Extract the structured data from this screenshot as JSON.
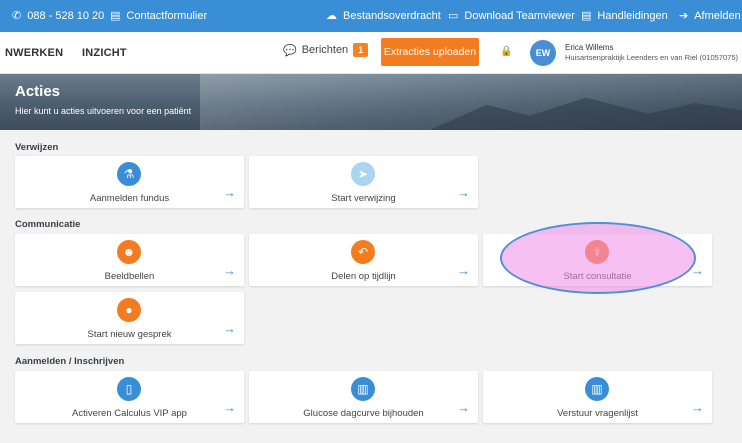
{
  "topbar": {
    "phone": "088 - 528 10 20",
    "contact": "Contactformulier",
    "transfer": "Bestandsoverdracht",
    "teamviewer": "Download Teamviewer",
    "manuals": "Handleidingen",
    "logout": "Afmelden"
  },
  "nav": {
    "tab1": "NWERKEN",
    "tab2": "INZICHT",
    "messages": "Berichten",
    "messages_count": "1",
    "upload": "Extracties uploaden",
    "avatar_initials": "EW",
    "user_name": "Erica Willems",
    "user_org": "Huisartsenpraktijk Leenders en van Riel (01057075)"
  },
  "banner": {
    "title": "Acties",
    "subtitle": "Hier kunt u acties uitvoeren voor een patiënt"
  },
  "sections": {
    "verwijzen": "Verwijzen",
    "communicatie": "Communicatie",
    "aanmelden": "Aanmelden / Inschrijven"
  },
  "cards": {
    "fundus": "Aanmelden fundus",
    "verwijzing": "Start verwijzing",
    "beeldbellen": "Beeldbellen",
    "tijdlijn": "Delen op tijdlijn",
    "consultatie": "Start consultatie",
    "gesprek": "Start nieuw gesprek",
    "calculus": "Activeren Calculus VIP app",
    "glucose": "Glucose dagcurve bijhouden",
    "vragenlijst": "Verstuur vragenlijst"
  },
  "colors": {
    "blue": "#3a8ed6",
    "orange": "#f47c20",
    "light_blue": "#a9d4f2",
    "highlight": "#f18cea"
  },
  "icons": {
    "phone": "phone-icon",
    "contact": "document-icon",
    "transfer": "cloud-upload-icon",
    "teamviewer": "monitor-icon",
    "manuals": "book-icon",
    "logout": "logout-icon",
    "messages": "chat-icon",
    "lock": "lock-icon",
    "arrow": "arrow-right-icon"
  }
}
